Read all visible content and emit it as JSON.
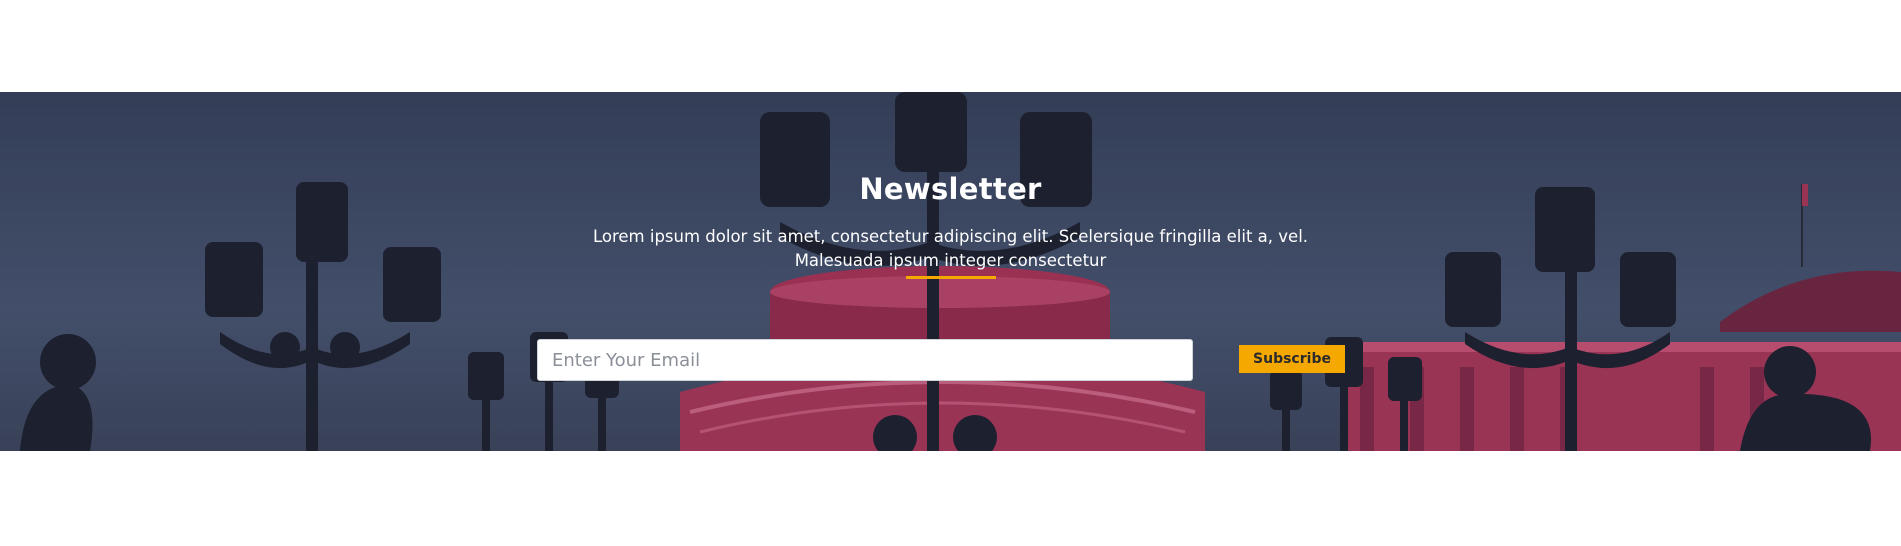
{
  "newsletter": {
    "title": "Newsletter",
    "description": "Lorem ipsum dolor sit amet, consectetur adipiscing elit. Scelersique fringilla elit a, vel. Malesuada ipsum integer consectetur",
    "email_placeholder": "Enter Your Email",
    "subscribe_label": "Subscribe"
  },
  "colors": {
    "accent": "#f5a800",
    "overlay": "#3b4763",
    "building": "#c2375f"
  },
  "background_image": "street-lamps-and-building-photo"
}
